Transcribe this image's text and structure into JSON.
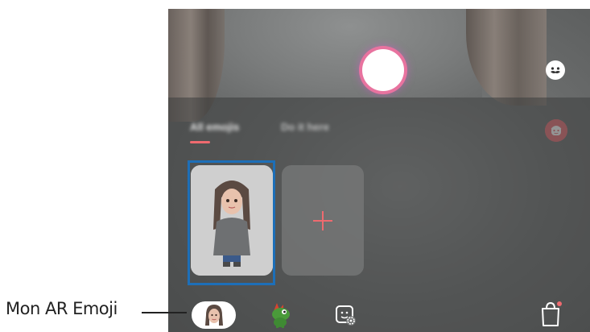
{
  "camera": {
    "tabs": [
      {
        "label": "All emojis",
        "selected": true
      },
      {
        "label": "Do it here",
        "selected": false
      }
    ],
    "emoji_cards": [
      {
        "type": "my-emoji",
        "selected": true
      },
      {
        "type": "add",
        "label": "+"
      }
    ],
    "side_buttons": [
      "mask-icon",
      "ar-emoji-icon"
    ],
    "bottom_bar": [
      "my-ar-emoji-avatar",
      "dino-sticker-icon",
      "sticker-settings-icon",
      "store-bag-icon"
    ]
  },
  "callout": {
    "label": "Mon AR Emoji"
  },
  "colors": {
    "accent": "#ef6a6f",
    "highlight": "#1d6fb8",
    "shutter_glow": "#e8739f"
  }
}
